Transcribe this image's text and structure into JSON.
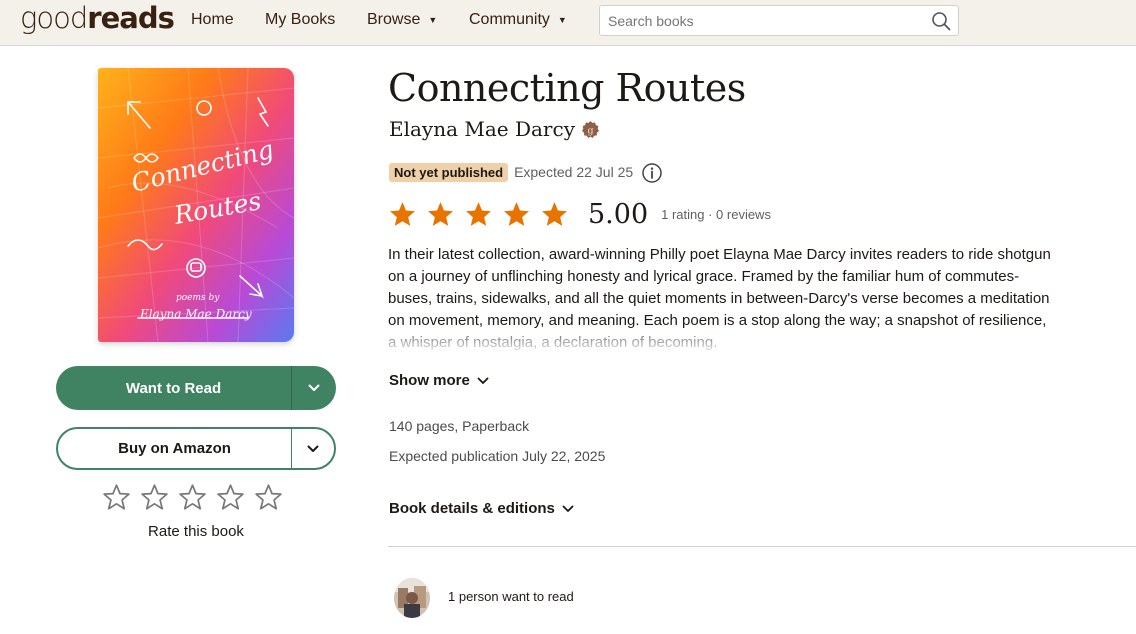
{
  "header": {
    "logo_light": "good",
    "logo_bold": "reads",
    "nav": {
      "home": "Home",
      "my_books": "My Books",
      "browse": "Browse",
      "community": "Community"
    },
    "search_placeholder": "Search books",
    "background": "#f4f1ea"
  },
  "book": {
    "title": "Connecting Routes",
    "author": "Elayna Mae Darcy",
    "author_badge_icon": "goodreads-author-badge-icon",
    "status_badge": "Not yet published",
    "expected": "Expected 22 Jul 25",
    "average_rating": "5.00",
    "average_rating_value": 5,
    "rating_counts": "1 rating · 0 reviews",
    "description": "In their latest collection, award-winning Philly poet Elayna Mae Darcy invites readers to ride shotgun on a journey of unflinching honesty and lyrical grace. Framed by the familiar hum of commutes-buses, trains, sidewalks, and all the quiet moments in between-Darcy's verse becomes a meditation on movement, memory, and meaning. Each poem is a stop along the way; a snapshot of resilience, a whisper of nostalgia, a declaration of becoming.",
    "show_more": "Show more",
    "pages_format": "140 pages, Paperback",
    "publication": "Expected publication July 22, 2025",
    "details_toggle": "Book details & editions",
    "want_to_read_count": "1 person want to read"
  },
  "cover": {
    "title_line1": "Connecting",
    "title_line2": "Routes",
    "byline": "poems by",
    "author": "Elayna Mae Darcy"
  },
  "actions": {
    "want_to_read": "Want to Read",
    "buy": "Buy on Amazon",
    "rate_label": "Rate this book",
    "user_rating_value": 0
  },
  "colors": {
    "brand_green": "#3f8363",
    "star_orange": "#e87400",
    "badge_bg": "#efd0a8",
    "text": "#1e1915"
  }
}
